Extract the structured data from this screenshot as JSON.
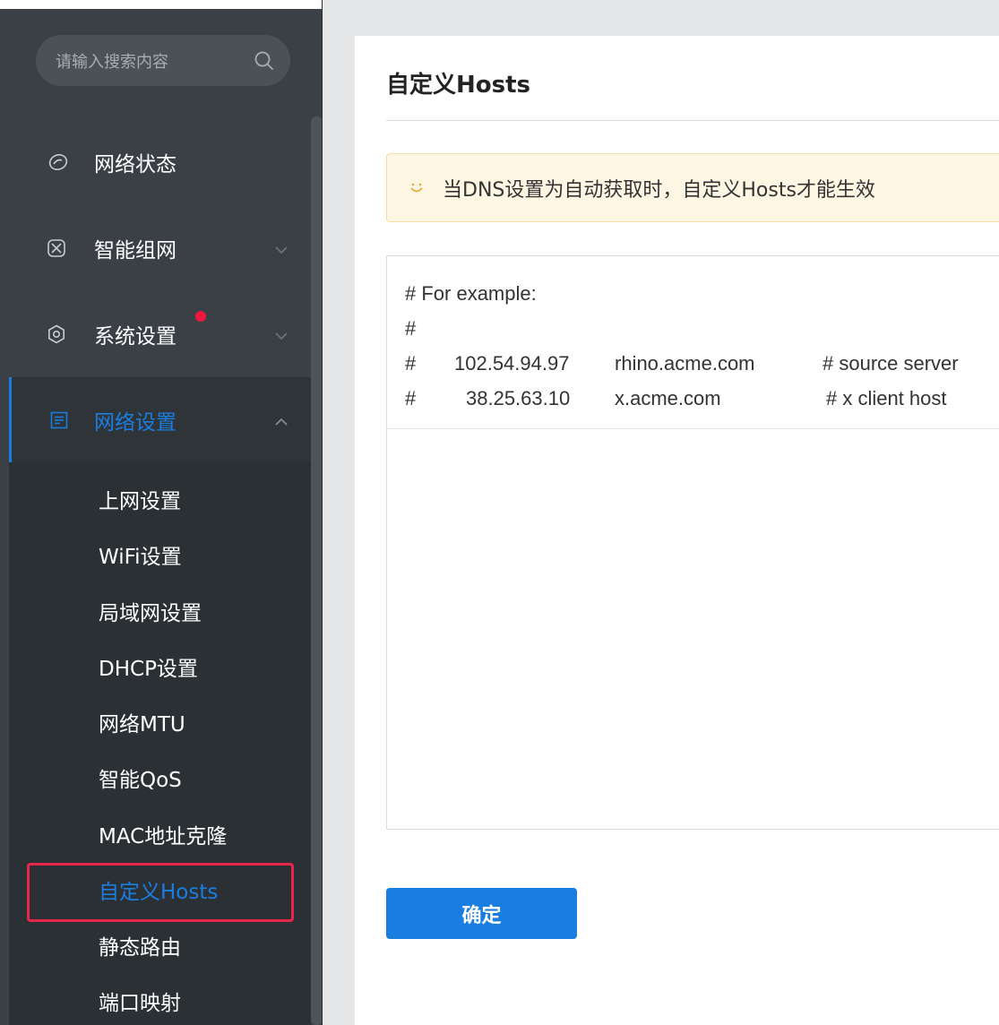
{
  "sidebar": {
    "search_placeholder": "请输入搜索内容",
    "menu": [
      {
        "label": "网络状态",
        "icon": "network-status-icon"
      },
      {
        "label": "智能组网",
        "icon": "mesh-network-icon"
      },
      {
        "label": "系统设置",
        "icon": "settings-gear-icon"
      },
      {
        "label": "网络设置",
        "icon": "document-list-icon"
      }
    ],
    "submenu": [
      "上网设置",
      "WiFi设置",
      "局域网设置",
      "DHCP设置",
      "网络MTU",
      "智能QoS",
      "MAC地址克隆",
      "自定义Hosts",
      "静态路由",
      "端口映射"
    ],
    "selected_submenu": "自定义Hosts"
  },
  "main": {
    "title": "自定义Hosts",
    "notice": "当DNS设置为自动获取时，自定义Hosts才能生效",
    "hosts_text": {
      "line1": "# For example:",
      "line2": "#",
      "line3": {
        "hash": "#",
        "ip": "102.54.94.97",
        "host": "rhino.acme.com",
        "comment": "# source server"
      },
      "line4": {
        "hash": "#",
        "ip": "38.25.63.10",
        "host": "x.acme.com",
        "comment": "# x client host"
      }
    },
    "confirm_label": "确定"
  },
  "colors": {
    "sidebar_bg": "#3a4046",
    "submenu_bg": "#2b3035",
    "accent": "#1a7de0",
    "badge_red": "#f0163f",
    "highlight_border": "#e8254c",
    "notice_bg": "#fdf6e3"
  }
}
